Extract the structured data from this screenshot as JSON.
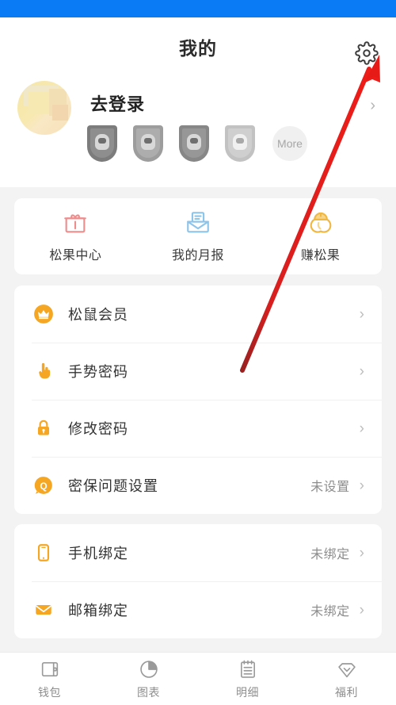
{
  "theme": {
    "status_bar_color": "#0b7bf5",
    "page_background": "#f3f3f3",
    "card_background": "#ffffff",
    "accent_orange": "#f5a623",
    "annotation_color": "#e01b1b"
  },
  "header": {
    "title": "我的",
    "settings_icon": "gear-icon"
  },
  "profile": {
    "avatar_icon": "avatar-image",
    "login_label": "去登录",
    "chevron": "›",
    "badges": [
      {
        "icon": "badge-shield-1"
      },
      {
        "icon": "badge-shield-2"
      },
      {
        "icon": "badge-shield-3"
      },
      {
        "icon": "badge-shield-4"
      }
    ],
    "more_label": "More"
  },
  "quick_actions": [
    {
      "label": "松果中心",
      "icon": "gift-box-icon",
      "color": "#ef8d8d"
    },
    {
      "label": "我的月报",
      "icon": "envelope-report-icon",
      "color": "#8cc4ea"
    },
    {
      "label": "赚松果",
      "icon": "acorn-icon",
      "color": "#f0b840"
    }
  ],
  "menu_group_1": [
    {
      "label": "松鼠会员",
      "icon": "crown-icon",
      "value": "",
      "chevron": "›"
    },
    {
      "label": "手势密码",
      "icon": "hand-pointer-icon",
      "value": "",
      "chevron": "›"
    },
    {
      "label": "修改密码",
      "icon": "lock-icon",
      "value": "",
      "chevron": "›"
    },
    {
      "label": "密保问题设置",
      "icon": "question-bubble-icon",
      "value": "未设置",
      "chevron": "›"
    }
  ],
  "menu_group_2": [
    {
      "label": "手机绑定",
      "icon": "phone-icon",
      "value": "未绑定",
      "chevron": "›"
    },
    {
      "label": "邮箱绑定",
      "icon": "mail-icon",
      "value": "未绑定",
      "chevron": "›"
    }
  ],
  "tabbar": [
    {
      "label": "钱包",
      "icon": "wallet-icon"
    },
    {
      "label": "图表",
      "icon": "pie-chart-icon"
    },
    {
      "label": "明细",
      "icon": "notepad-icon"
    },
    {
      "label": "福利",
      "icon": "diamond-icon"
    }
  ],
  "annotation": {
    "type": "arrow",
    "points_to": "gear-icon"
  }
}
